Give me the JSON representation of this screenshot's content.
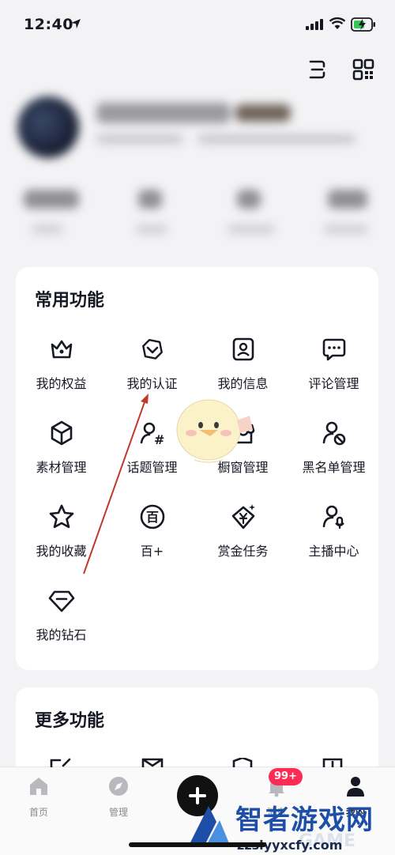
{
  "status_bar": {
    "time": "12:40"
  },
  "common": {
    "title": "常用功能",
    "items": [
      {
        "label": "我的权益"
      },
      {
        "label": "我的认证"
      },
      {
        "label": "我的信息"
      },
      {
        "label": "评论管理"
      },
      {
        "label": "素材管理"
      },
      {
        "label": "话题管理"
      },
      {
        "label": "橱窗管理"
      },
      {
        "label": "黑名单管理"
      },
      {
        "label": "我的收藏"
      },
      {
        "label": "百+"
      },
      {
        "label": "赏金任务"
      },
      {
        "label": "主播中心"
      },
      {
        "label": "我的钻石"
      }
    ]
  },
  "more": {
    "title": "更多功能"
  },
  "tabbar": {
    "tabs": [
      {
        "label": "首页"
      },
      {
        "label": "管理"
      },
      {
        "label": ""
      },
      {
        "label": "消息"
      },
      {
        "label": "我的"
      }
    ],
    "badge": "99+"
  },
  "watermark": {
    "title": "智者游戏网",
    "url": "zzslyyxcfy.com",
    "game": "GAME"
  },
  "colors": {
    "accent": "#fe2c55",
    "arrow": "#c0392b",
    "watermark": "#1e4fa8"
  }
}
